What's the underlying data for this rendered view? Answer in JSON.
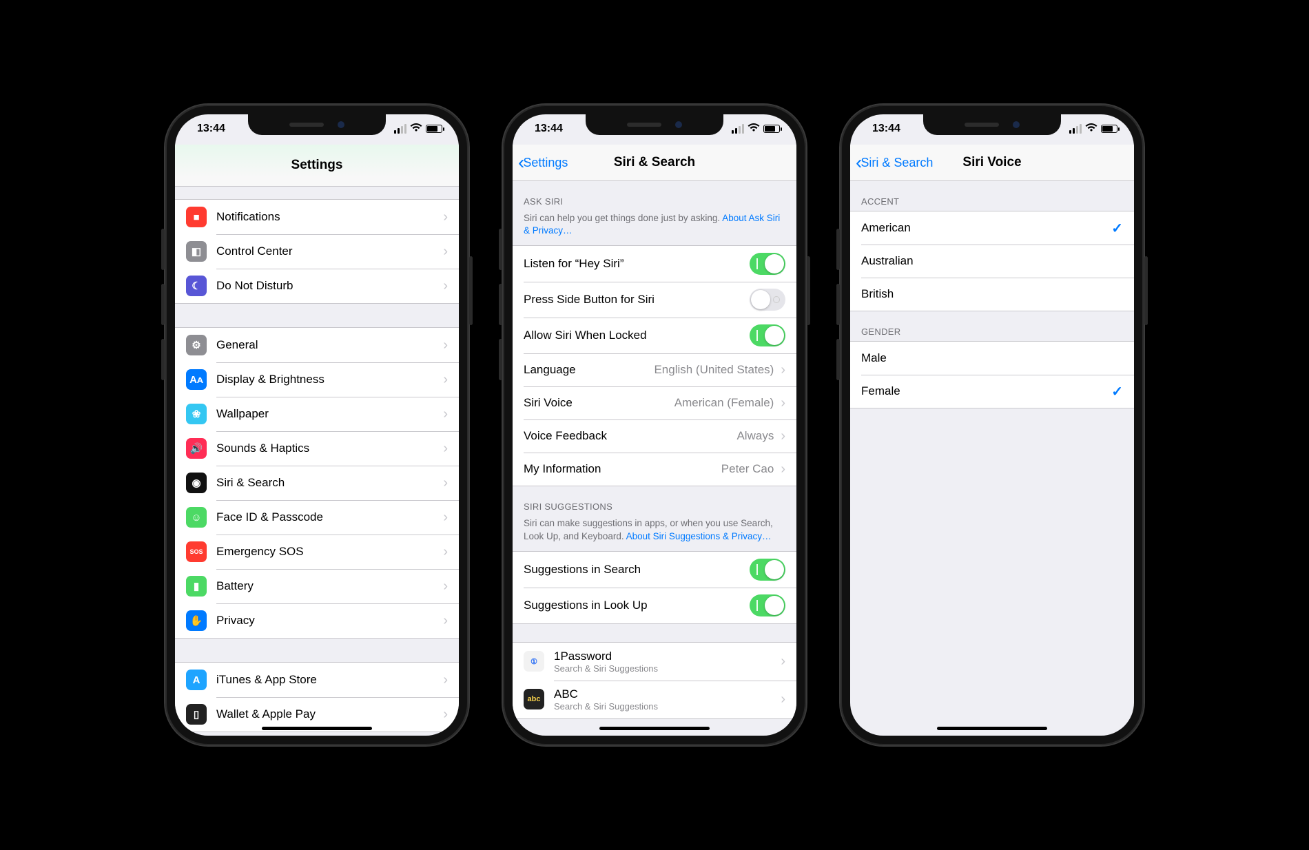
{
  "status": {
    "time": "13:44"
  },
  "phone1": {
    "title": "Settings",
    "group1": [
      {
        "icon": "notifications-icon",
        "bg": "#FF3B30",
        "label": "Notifications",
        "glyph": "■"
      },
      {
        "icon": "control-center-icon",
        "bg": "#8E8E93",
        "label": "Control Center",
        "glyph": "◧"
      },
      {
        "icon": "dnd-icon",
        "bg": "#5856D6",
        "label": "Do Not Disturb",
        "glyph": "☾"
      }
    ],
    "group2": [
      {
        "icon": "general-icon",
        "bg": "#8E8E93",
        "label": "General",
        "glyph": "⚙"
      },
      {
        "icon": "display-icon",
        "bg": "#007AFF",
        "label": "Display & Brightness",
        "glyph": "Aᴀ"
      },
      {
        "icon": "wallpaper-icon",
        "bg": "#34C7F2",
        "label": "Wallpaper",
        "glyph": "❀"
      },
      {
        "icon": "sounds-icon",
        "bg": "#FF2D55",
        "label": "Sounds & Haptics",
        "glyph": "🔊"
      },
      {
        "icon": "siri-icon",
        "bg": "#111",
        "label": "Siri & Search",
        "glyph": "◉"
      },
      {
        "icon": "faceid-icon",
        "bg": "#4CD964",
        "label": "Face ID & Passcode",
        "glyph": "☺"
      },
      {
        "icon": "sos-icon",
        "bg": "#FF3B30",
        "label": "Emergency SOS",
        "glyph": "SOS"
      },
      {
        "icon": "battery-icon",
        "bg": "#4CD964",
        "label": "Battery",
        "glyph": "▮"
      },
      {
        "icon": "privacy-icon",
        "bg": "#007AFF",
        "label": "Privacy",
        "glyph": "✋"
      }
    ],
    "group3": [
      {
        "icon": "itunes-icon",
        "bg": "#1EA4FF",
        "label": "iTunes & App Store",
        "glyph": "A"
      },
      {
        "icon": "wallet-icon",
        "bg": "#222",
        "label": "Wallet & Apple Pay",
        "glyph": "▯"
      }
    ]
  },
  "phone2": {
    "back": "Settings",
    "title": "Siri & Search",
    "section1": {
      "header": "ASK SIRI",
      "footer_text": "Siri can help you get things done just by asking. ",
      "footer_link": "About Ask Siri & Privacy…",
      "rows": [
        {
          "label": "Listen for “Hey Siri”",
          "toggle": true
        },
        {
          "label": "Press Side Button for Siri",
          "toggle": false
        },
        {
          "label": "Allow Siri When Locked",
          "toggle": true
        },
        {
          "label": "Language",
          "detail": "English (United States)",
          "disclosure": true
        },
        {
          "label": "Siri Voice",
          "detail": "American (Female)",
          "disclosure": true
        },
        {
          "label": "Voice Feedback",
          "detail": "Always",
          "disclosure": true
        },
        {
          "label": "My Information",
          "detail": "Peter Cao",
          "disclosure": true
        }
      ]
    },
    "section2": {
      "header": "SIRI SUGGESTIONS",
      "footer_text": "Siri can make suggestions in apps, or when you use Search, Look Up, and Keyboard. ",
      "footer_link": "About Siri Suggestions & Privacy…",
      "rows": [
        {
          "label": "Suggestions in Search",
          "toggle": true
        },
        {
          "label": "Suggestions in Look Up",
          "toggle": true
        }
      ]
    },
    "apps": [
      {
        "icon_bg": "#F2F2F2",
        "icon_fg": "#1E66F5",
        "glyph": "①",
        "title": "1Password",
        "subtitle": "Search & Siri Suggestions"
      },
      {
        "icon_bg": "#222",
        "icon_fg": "#F8D24C",
        "glyph": "abc",
        "title": "ABC",
        "subtitle": "Search & Siri Suggestions"
      }
    ]
  },
  "phone3": {
    "back": "Siri & Search",
    "title": "Siri Voice",
    "accent_header": "ACCENT",
    "accents": [
      {
        "label": "American",
        "checked": true
      },
      {
        "label": "Australian",
        "checked": false
      },
      {
        "label": "British",
        "checked": false
      }
    ],
    "gender_header": "GENDER",
    "genders": [
      {
        "label": "Male",
        "checked": false
      },
      {
        "label": "Female",
        "checked": true
      }
    ]
  }
}
